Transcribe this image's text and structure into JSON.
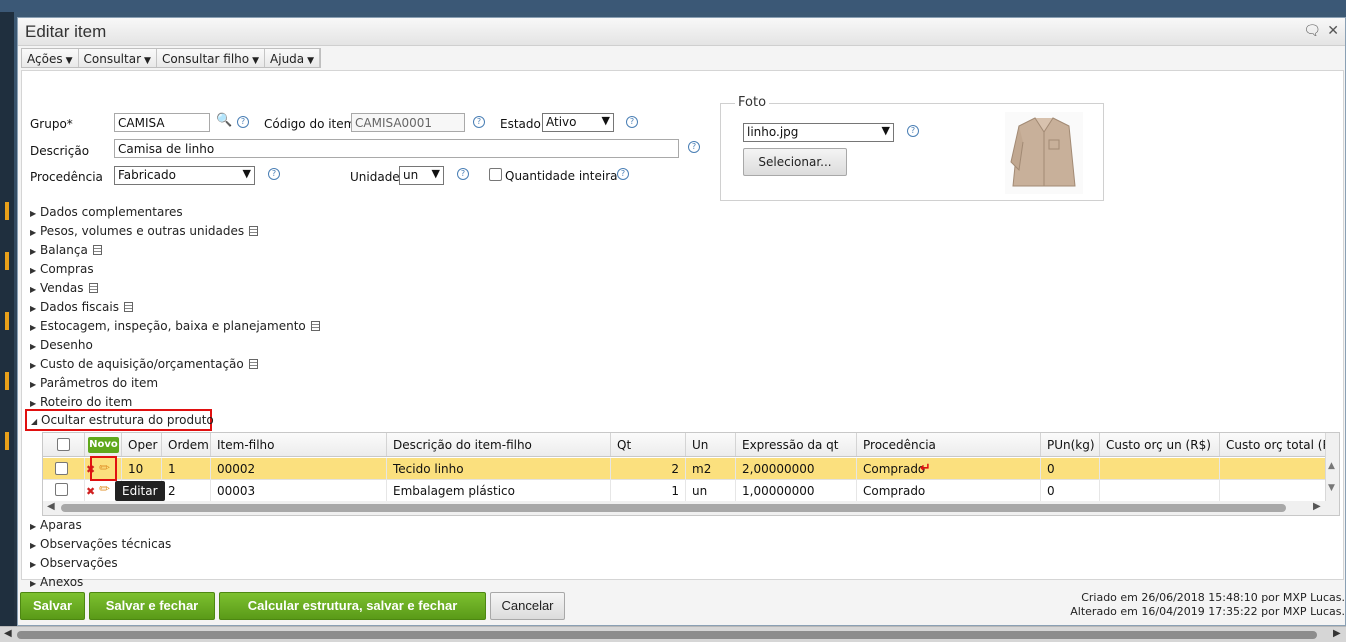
{
  "window": {
    "title": "Editar item"
  },
  "menu": [
    {
      "label": "Ações"
    },
    {
      "label": "Consultar"
    },
    {
      "label": "Consultar filho"
    },
    {
      "label": "Ajuda"
    }
  ],
  "form": {
    "grupo_label": "Grupo*",
    "grupo_value": "CAMISA",
    "codigo_label": "Código do item",
    "codigo_value": "CAMISA0001",
    "estado_label": "Estado",
    "estado_value": "Ativo",
    "descricao_label": "Descrição",
    "descricao_value": "Camisa de linho",
    "procedencia_label": "Procedência",
    "procedencia_value": "Fabricado",
    "unidade_label": "Unidade",
    "unidade_value": "un",
    "qtd_inteira_label": "Quantidade inteira",
    "qtd_inteira_checked": false
  },
  "foto": {
    "legend": "Foto",
    "file": "linho.jpg",
    "select_button": "Selecionar..."
  },
  "sections": [
    {
      "label": "Dados complementares",
      "doc": false
    },
    {
      "label": "Pesos, volumes e outras unidades",
      "doc": true
    },
    {
      "label": "Balança",
      "doc": true
    },
    {
      "label": "Compras",
      "doc": false
    },
    {
      "label": "Vendas",
      "doc": true
    },
    {
      "label": "Dados fiscais",
      "doc": true
    },
    {
      "label": "Estocagem, inspeção, baixa e planejamento",
      "doc": true
    },
    {
      "label": "Desenho",
      "doc": false
    },
    {
      "label": "Custo de aquisição/orçamentação",
      "doc": true
    },
    {
      "label": "Parâmetros do item",
      "doc": false
    },
    {
      "label": "Roteiro do item",
      "doc": false
    }
  ],
  "estrutura": {
    "toggle_label": "Ocultar estrutura do produto",
    "novo_label": "Novo",
    "columns": [
      "Oper",
      "Ordem",
      "Item-filho",
      "Descrição do item-filho",
      "Qt",
      "Un",
      "Expressão da qt",
      "Procedência",
      "PUn(kg)",
      "Custo orç un (R$)",
      "Custo orç total (R$"
    ],
    "rows": [
      {
        "oper": "10",
        "ordem": "1",
        "item": "00002",
        "descricao": "Tecido linho",
        "qt": "2",
        "un": "m2",
        "expressao": "2,00000000",
        "procedencia": "Comprado",
        "pun": "0",
        "custo_un": "",
        "custo_total": ""
      },
      {
        "oper": "",
        "ordem": "2",
        "item": "00003",
        "descricao": "Embalagem plástico",
        "qt": "1",
        "un": "un",
        "expressao": "1,00000000",
        "procedencia": "Comprado",
        "pun": "0",
        "custo_un": "",
        "custo_total": ""
      }
    ],
    "tooltip": "Editar"
  },
  "sections_after": [
    {
      "label": "Aparas"
    },
    {
      "label": "Observações técnicas"
    },
    {
      "label": "Observações"
    },
    {
      "label": "Anexos"
    }
  ],
  "footer": {
    "salvar": "Salvar",
    "salvar_fechar": "Salvar e fechar",
    "calcular": "Calcular estrutura, salvar e fechar",
    "cancelar": "Cancelar",
    "criado": "Criado em 26/06/2018 15:48:10 por MXP Lucas.",
    "alterado": "Alterado em 16/04/2019 17:35:22 por MXP Lucas."
  },
  "colors": {
    "accent_green": "#5fa81c",
    "highlight_row": "#fbe07e",
    "highlight_border": "#e01010"
  }
}
